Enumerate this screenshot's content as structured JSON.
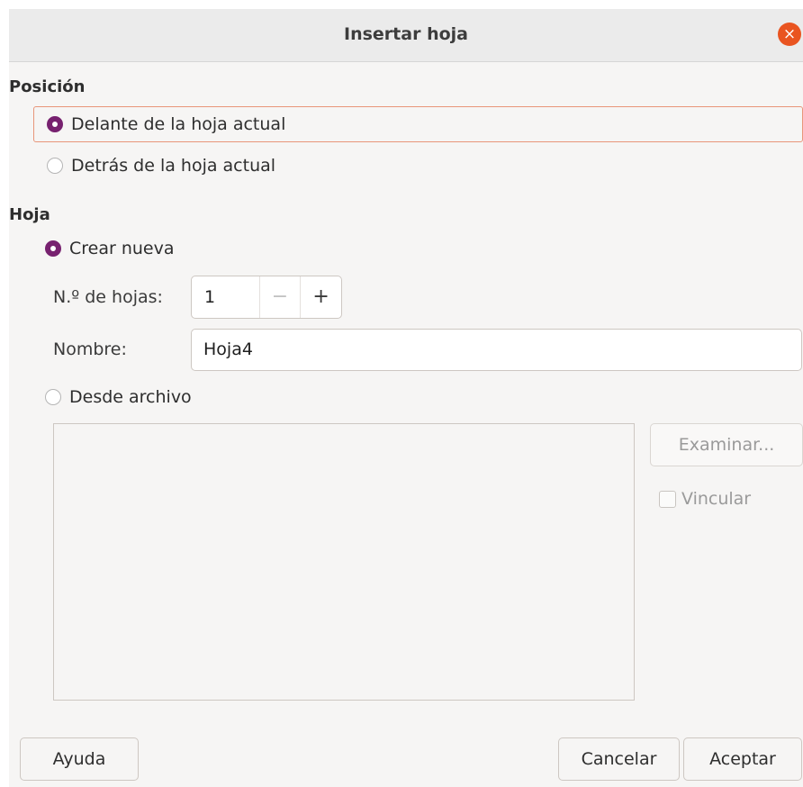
{
  "dialog": {
    "title": "Insertar hoja",
    "close_icon": "×"
  },
  "position": {
    "heading": "Posición",
    "options": [
      {
        "label": "Delante de la hoja actual",
        "selected": true
      },
      {
        "label": "Detrás de la hoja actual",
        "selected": false
      }
    ]
  },
  "sheet": {
    "heading": "Hoja",
    "create_new": {
      "label": "Crear nueva",
      "selected": true
    },
    "count": {
      "label": "N.º de hojas:",
      "value": "1",
      "minus": "−",
      "plus": "+"
    },
    "name": {
      "label": "Nombre:",
      "value": "Hoja4"
    },
    "from_file": {
      "label": "Desde archivo",
      "selected": false
    },
    "browse_label": "Examinar...",
    "link_label": "Vincular"
  },
  "footer": {
    "help_label": "Ayuda",
    "cancel_label": "Cancelar",
    "ok_label": "Aceptar"
  },
  "colors": {
    "accent": "#77216f",
    "close": "#e95420",
    "focus_border": "#e8967a"
  }
}
